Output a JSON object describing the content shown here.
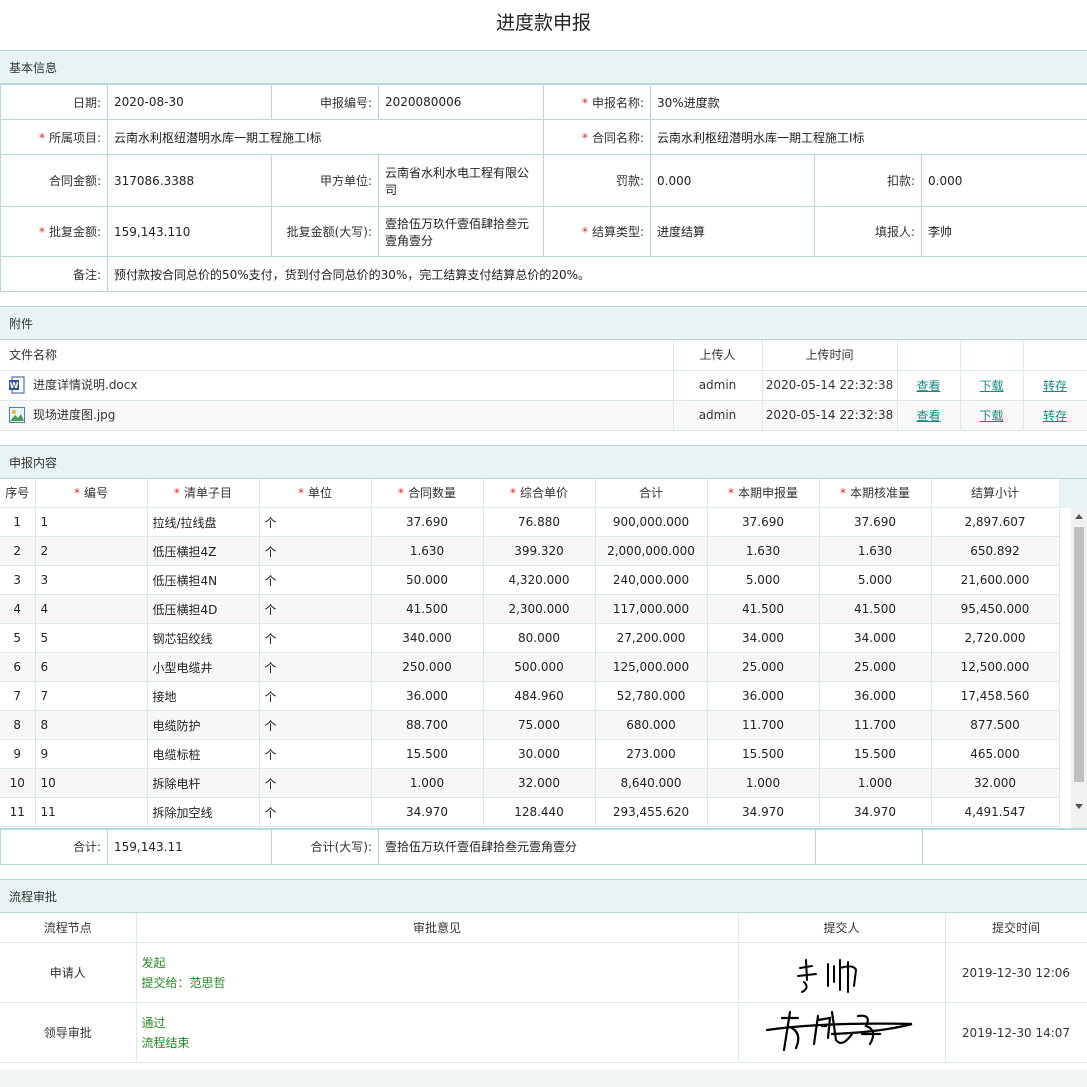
{
  "page": {
    "title": "进度款申报"
  },
  "sections": {
    "basic": "基本信息",
    "attachments": "附件",
    "content": "申报内容",
    "approval": "流程审批"
  },
  "basic": {
    "date_label": "日期:",
    "date": "2020-08-30",
    "number_label": "申报编号:",
    "number": "2020080006",
    "name_label": "申报名称:",
    "name": "30%进度款",
    "project_label": "所属项目:",
    "project": "云南水利枢纽潜明水库一期工程施工I标",
    "contract_name_label": "合同名称:",
    "contract_name": "云南水利枢纽潜明水库一期工程施工I标",
    "contract_amount_label": "合同金额:",
    "contract_amount": "317086.3388",
    "party_a_label": "甲方单位:",
    "party_a": "云南省水利水电工程有限公司",
    "penalty_label": "罚款:",
    "penalty": "0.000",
    "deduct_label": "扣款:",
    "deduct": "0.000",
    "approved_label": "批复金额:",
    "approved": "159,143.110",
    "approved_upper_label": "批复金额(大写):",
    "approved_upper": "壹拾伍万玖仟壹佰肆拾叁元壹角壹分",
    "settle_type_label": "结算类型:",
    "settle_type": "进度结算",
    "filler_label": "填报人:",
    "filler": "李帅",
    "remark_label": "备注:",
    "remark": "预付款按合同总价的50%支付，货到付合同总价的30%，完工结算支付结算总价的20%。"
  },
  "attachments": {
    "headers": {
      "name": "文件名称",
      "uploader": "上传人",
      "time": "上传时间"
    },
    "rows": [
      {
        "icon": "word-doc-icon",
        "name": "进度详情说明.docx",
        "uploader": "admin",
        "time": "2020-05-14 22:32:38",
        "view": "查看",
        "download": "下载",
        "transfer": "转存"
      },
      {
        "icon": "image-file-icon",
        "name": "现场进度图.jpg",
        "uploader": "admin",
        "time": "2020-05-14 22:32:38",
        "view": "查看",
        "download": "下载",
        "transfer": "转存"
      }
    ]
  },
  "grid": {
    "headers": [
      "序号",
      "编号",
      "清单子目",
      "单位",
      "合同数量",
      "综合单价",
      "合计",
      "本期申报量",
      "本期核准量",
      "结算小计"
    ],
    "required": [
      false,
      true,
      true,
      true,
      true,
      true,
      false,
      true,
      true,
      false
    ],
    "rows": [
      [
        "1",
        "1",
        "拉线/拉线盘",
        "个",
        "37.690",
        "76.880",
        "900,000.000",
        "37.690",
        "37.690",
        "2,897.607"
      ],
      [
        "2",
        "2",
        "低压横担4Z",
        "个",
        "1.630",
        "399.320",
        "2,000,000.000",
        "1.630",
        "1.630",
        "650.892"
      ],
      [
        "3",
        "3",
        "低压横担4N",
        "个",
        "50.000",
        "4,320.000",
        "240,000.000",
        "5.000",
        "5.000",
        "21,600.000"
      ],
      [
        "4",
        "4",
        "低压横担4D",
        "个",
        "41.500",
        "2,300.000",
        "117,000.000",
        "41.500",
        "41.500",
        "95,450.000"
      ],
      [
        "5",
        "5",
        "钢芯铝绞线",
        "个",
        "340.000",
        "80.000",
        "27,200.000",
        "34.000",
        "34.000",
        "2,720.000"
      ],
      [
        "6",
        "6",
        "小型电缆井",
        "个",
        "250.000",
        "500.000",
        "125,000.000",
        "25.000",
        "25.000",
        "12,500.000"
      ],
      [
        "7",
        "7",
        "接地",
        "个",
        "36.000",
        "484.960",
        "52,780.000",
        "36.000",
        "36.000",
        "17,458.560"
      ],
      [
        "8",
        "8",
        "电缆防护",
        "个",
        "88.700",
        "75.000",
        "680.000",
        "11.700",
        "11.700",
        "877.500"
      ],
      [
        "9",
        "9",
        "电缆标桩",
        "个",
        "15.500",
        "30.000",
        "273.000",
        "15.500",
        "15.500",
        "465.000"
      ],
      [
        "10",
        "10",
        "拆除电杆",
        "个",
        "1.000",
        "32.000",
        "8,640.000",
        "1.000",
        "1.000",
        "32.000"
      ],
      [
        "11",
        "11",
        "拆除加空线",
        "个",
        "34.970",
        "128.440",
        "293,455.620",
        "34.970",
        "34.970",
        "4,491.547"
      ]
    ]
  },
  "totals": {
    "sum_label": "合计:",
    "sum": "159,143.11",
    "upper_label": "合计(大写):",
    "upper": "壹拾伍万玖仟壹佰肆拾叁元壹角壹分"
  },
  "approval": {
    "headers": {
      "node": "流程节点",
      "opinion": "审批意见",
      "submitter": "提交人",
      "time": "提交时间"
    },
    "rows": [
      {
        "node": "申请人",
        "opinion1": "发起",
        "opinion2": "提交给：范思哲",
        "signature": "李帅",
        "time": "2019-12-30 12:06"
      },
      {
        "node": "领导审批",
        "opinion1": "通过",
        "opinion2": "流程结束",
        "signature": "范思哲",
        "time": "2019-12-30 14:07"
      }
    ]
  },
  "colors": {
    "accent": "#1a8a80",
    "header_bg": "#e8f4f4",
    "border": "#b6d8d8",
    "required": "#e0281e",
    "approval_text": "#228b22"
  }
}
